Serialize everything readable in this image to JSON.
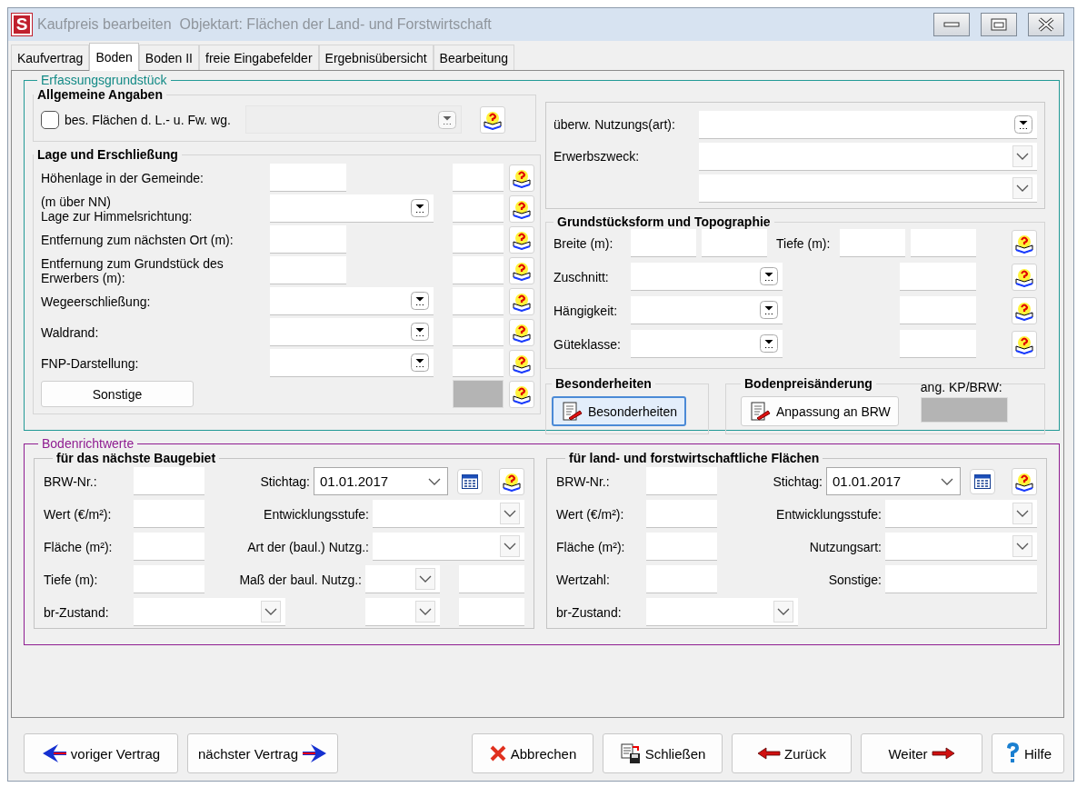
{
  "window": {
    "icon_letter": "S",
    "title": "Kaufpreis bearbeiten  Objektart: Flächen der Land- und Forstwirtschaft"
  },
  "tabs": [
    {
      "label": "Kaufvertrag",
      "selected": false
    },
    {
      "label": "Boden",
      "selected": true
    },
    {
      "label": "Boden II",
      "selected": false
    },
    {
      "label": "freie Eingabefelder",
      "selected": false
    },
    {
      "label": "Ergebnisübersicht",
      "selected": false
    },
    {
      "label": "Bearbeitung",
      "selected": false
    }
  ],
  "erfassung": {
    "title": "Erfassungsgrundstück",
    "allgemeine": {
      "title": "Allgemeine Angaben",
      "checkbox": {
        "label": "bes. Flächen d. L.- u. Fw. wg.",
        "checked": false
      },
      "select": {
        "disabled": true
      }
    },
    "lage": {
      "title": "Lage und Erschließung",
      "rows": [
        {
          "label": "Höhenlage in der Gemeinde:",
          "kind": "text",
          "box_disabled": false
        },
        {
          "note": "(m über NN)",
          "label": "Lage zur Himmelsrichtung:",
          "kind": "combo",
          "box_disabled": false
        },
        {
          "label": "Entfernung zum nächsten Ort (m):",
          "kind": "text",
          "box_disabled": false
        },
        {
          "label": "Entfernung zum Grundstück des Erwerbers (m):",
          "kind": "text",
          "box_disabled": false
        },
        {
          "label": "Wegeerschließung:",
          "kind": "combo",
          "box_disabled": false
        },
        {
          "label": "Waldrand:",
          "kind": "combo",
          "box_disabled": false
        },
        {
          "label": "FNP-Darstellung:",
          "kind": "combo",
          "box_disabled": false
        },
        {
          "label": "Sonstige",
          "kind": "button",
          "box_disabled": true
        }
      ]
    },
    "nutzung": {
      "rows": [
        {
          "label": "überw. Nutzungs(art):",
          "kind": "combo"
        },
        {
          "label": "Erwerbszweck:",
          "kind": "dropdown"
        },
        {
          "kind": "dropdown"
        }
      ]
    },
    "form": {
      "title": "Grundstücksform und Topographie",
      "width_label": "Breite (m):",
      "depth_label": "Tiefe (m):",
      "rows": [
        {
          "label": "Zuschnitt:"
        },
        {
          "label": "Hängigkeit:"
        },
        {
          "label": "Güteklasse:"
        }
      ]
    },
    "besonderheiten": {
      "title": "Besonderheiten",
      "button": {
        "label": "Besonderheiten",
        "focused": true
      }
    },
    "bodenpreis": {
      "title": "Bodenpreisänderung",
      "button": {
        "label": "Anpassung an BRW",
        "focused": false
      },
      "ratio_label": "ang. KP/BRW:",
      "ratio_disabled": true
    }
  },
  "bodenrichtwerte": {
    "title": "Bodenrichtwerte",
    "groups": [
      {
        "title": "für das nächste Baugebiet",
        "rows": [
          {
            "left": {
              "label": "BRW-Nr.:",
              "kind": "text"
            },
            "right": {
              "label": "Stichtag:",
              "kind": "date",
              "value": "01.01.2017"
            }
          },
          {
            "left": {
              "label": "Wert (€/m²):",
              "kind": "text"
            },
            "right": {
              "label": "Entwicklungsstufe:",
              "kind": "dropdown"
            }
          },
          {
            "left": {
              "label": "Fläche (m²):",
              "kind": "text"
            },
            "right": {
              "label": "Art der (baul.) Nutzg.:",
              "kind": "dropdown"
            }
          },
          {
            "left": {
              "label": "Tiefe (m):",
              "kind": "text"
            },
            "right": {
              "label": "Maß der baul. Nutzg.:",
              "kind": "split"
            }
          },
          {
            "left": {
              "label": "br-Zustand:",
              "kind": "dropdown"
            },
            "right": {
              "kind": "split"
            }
          }
        ]
      },
      {
        "title": "für land- und forstwirtschaftliche Flächen",
        "rows": [
          {
            "left": {
              "label": "BRW-Nr.:",
              "kind": "text"
            },
            "right": {
              "label": "Stichtag:",
              "kind": "date",
              "value": "01.01.2017"
            }
          },
          {
            "left": {
              "label": "Wert (€/m²):",
              "kind": "text"
            },
            "right": {
              "label": "Entwicklungsstufe:",
              "kind": "dropdown"
            }
          },
          {
            "left": {
              "label": "Fläche (m²):",
              "kind": "text"
            },
            "right": {
              "label": "Nutzungsart:",
              "kind": "dropdown"
            }
          },
          {
            "left": {
              "label": "Wertzahl:",
              "kind": "text"
            },
            "right": {
              "label": "Sonstige:",
              "kind": "text"
            }
          },
          {
            "left": {
              "label": "br-Zustand:",
              "kind": "dropdown"
            }
          }
        ]
      }
    ]
  },
  "buttons": [
    {
      "label": "voriger Vertrag",
      "kind": "prev"
    },
    {
      "label": "nächster Vertrag",
      "kind": "next"
    },
    {
      "label": "Abbrechen",
      "kind": "cancel"
    },
    {
      "label": "Schließen",
      "kind": "close"
    },
    {
      "label": "Zurück",
      "kind": "back"
    },
    {
      "label": "Weiter",
      "kind": "forward"
    },
    {
      "label": "Hilfe",
      "kind": "help"
    }
  ]
}
